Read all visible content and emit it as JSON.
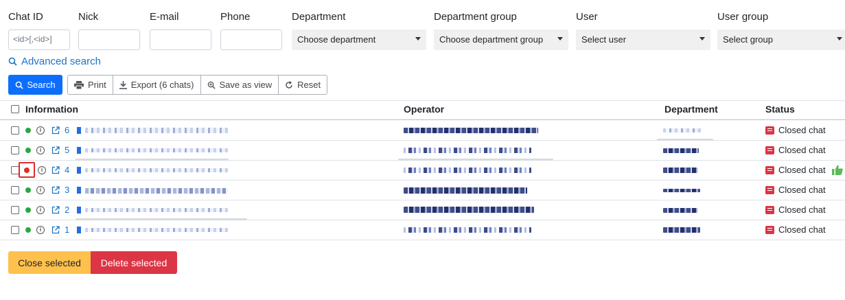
{
  "filters": {
    "chat_id": {
      "label": "Chat ID",
      "placeholder": "<id>[,<id>]"
    },
    "nick": {
      "label": "Nick"
    },
    "email": {
      "label": "E-mail"
    },
    "phone": {
      "label": "Phone"
    },
    "department": {
      "label": "Department",
      "value": "Choose department"
    },
    "department_group": {
      "label": "Department group",
      "value": "Choose department group"
    },
    "user": {
      "label": "User",
      "value": "Select user"
    },
    "user_group": {
      "label": "User group",
      "value": "Select group"
    }
  },
  "advanced_search": "Advanced search",
  "toolbar": {
    "search": "Search",
    "print": "Print",
    "export": "Export (6 chats)",
    "save_view": "Save as view",
    "reset": "Reset"
  },
  "table": {
    "headers": {
      "information": "Information",
      "operator": "Operator",
      "department": "Department",
      "status": "Status"
    },
    "rows": [
      {
        "id": "6",
        "status": "Closed chat",
        "online": "green"
      },
      {
        "id": "5",
        "status": "Closed chat",
        "online": "green"
      },
      {
        "id": "4",
        "status": "Closed chat",
        "online": "red",
        "thumbs_up": true
      },
      {
        "id": "3",
        "status": "Closed chat",
        "online": "green"
      },
      {
        "id": "2",
        "status": "Closed chat",
        "online": "green"
      },
      {
        "id": "1",
        "status": "Closed chat",
        "online": "green"
      }
    ]
  },
  "actions": {
    "close_selected": "Close selected",
    "delete_selected": "Delete selected"
  },
  "colors": {
    "primary": "#0d6efd",
    "danger": "#dc3545",
    "warning": "#ffc14d",
    "online": "#28a745",
    "offline": "#dc3545",
    "link": "#1b74c7"
  }
}
